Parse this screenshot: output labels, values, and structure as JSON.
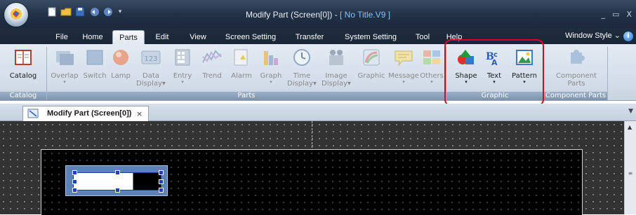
{
  "window": {
    "title_prefix": "Modify Part (Screen[0]) - ",
    "title_doc": "[ No Title.V9 ]",
    "controls": [
      "_",
      "▭",
      "X"
    ]
  },
  "ribbon_tabs": [
    "File",
    "Home",
    "Parts",
    "Edit",
    "View",
    "Screen Setting",
    "Transfer",
    "System Setting",
    "Tool",
    "Help"
  ],
  "active_tab": "Parts",
  "window_style": "Window Style",
  "help_icon": "i",
  "groups": {
    "catalog": {
      "label": "Catalog",
      "items": [
        {
          "label": "Catalog",
          "icon": "catalog-book-icon"
        }
      ]
    },
    "parts": {
      "label": "Parts",
      "items": [
        {
          "label": "Overlap",
          "icon": "overlap-icon"
        },
        {
          "label": "Switch",
          "icon": "switch-icon"
        },
        {
          "label": "Lamp",
          "icon": "lamp-icon"
        },
        {
          "label": "Data",
          "label2": "Display",
          "icon": "data-display-icon",
          "dropdown": true
        },
        {
          "label": "Entry",
          "icon": "entry-icon"
        },
        {
          "label": "Trend",
          "icon": "trend-icon"
        },
        {
          "label": "Alarm",
          "icon": "alarm-icon"
        },
        {
          "label": "Graph",
          "icon": "graph-icon"
        },
        {
          "label": "Time",
          "label2": "Display",
          "icon": "clock-icon",
          "dropdown": true
        },
        {
          "label": "Image",
          "label2": "Display",
          "icon": "image-display-icon",
          "dropdown": true
        },
        {
          "label": "Graphic",
          "icon": "graphic-icon"
        },
        {
          "label": "Message",
          "icon": "message-icon"
        },
        {
          "label": "Others",
          "icon": "others-icon"
        }
      ]
    },
    "graphic": {
      "label": "Graphic",
      "items": [
        {
          "label": "Shape",
          "icon": "shape-icon"
        },
        {
          "label": "Text",
          "icon": "text-icon"
        },
        {
          "label": "Pattern",
          "icon": "pattern-icon"
        }
      ]
    },
    "component": {
      "label": "Component Parts",
      "items": [
        {
          "label": "Component",
          "label2": "Parts",
          "icon": "component-parts-icon"
        }
      ]
    }
  },
  "doc_tab": {
    "label": "Modify Part (Screen[0])",
    "close": "×"
  },
  "colors": {
    "highlight": "#e3001b",
    "canvas_bg": "#333333",
    "screen_bg": "#000000",
    "part_frame": "#5b83b8"
  }
}
